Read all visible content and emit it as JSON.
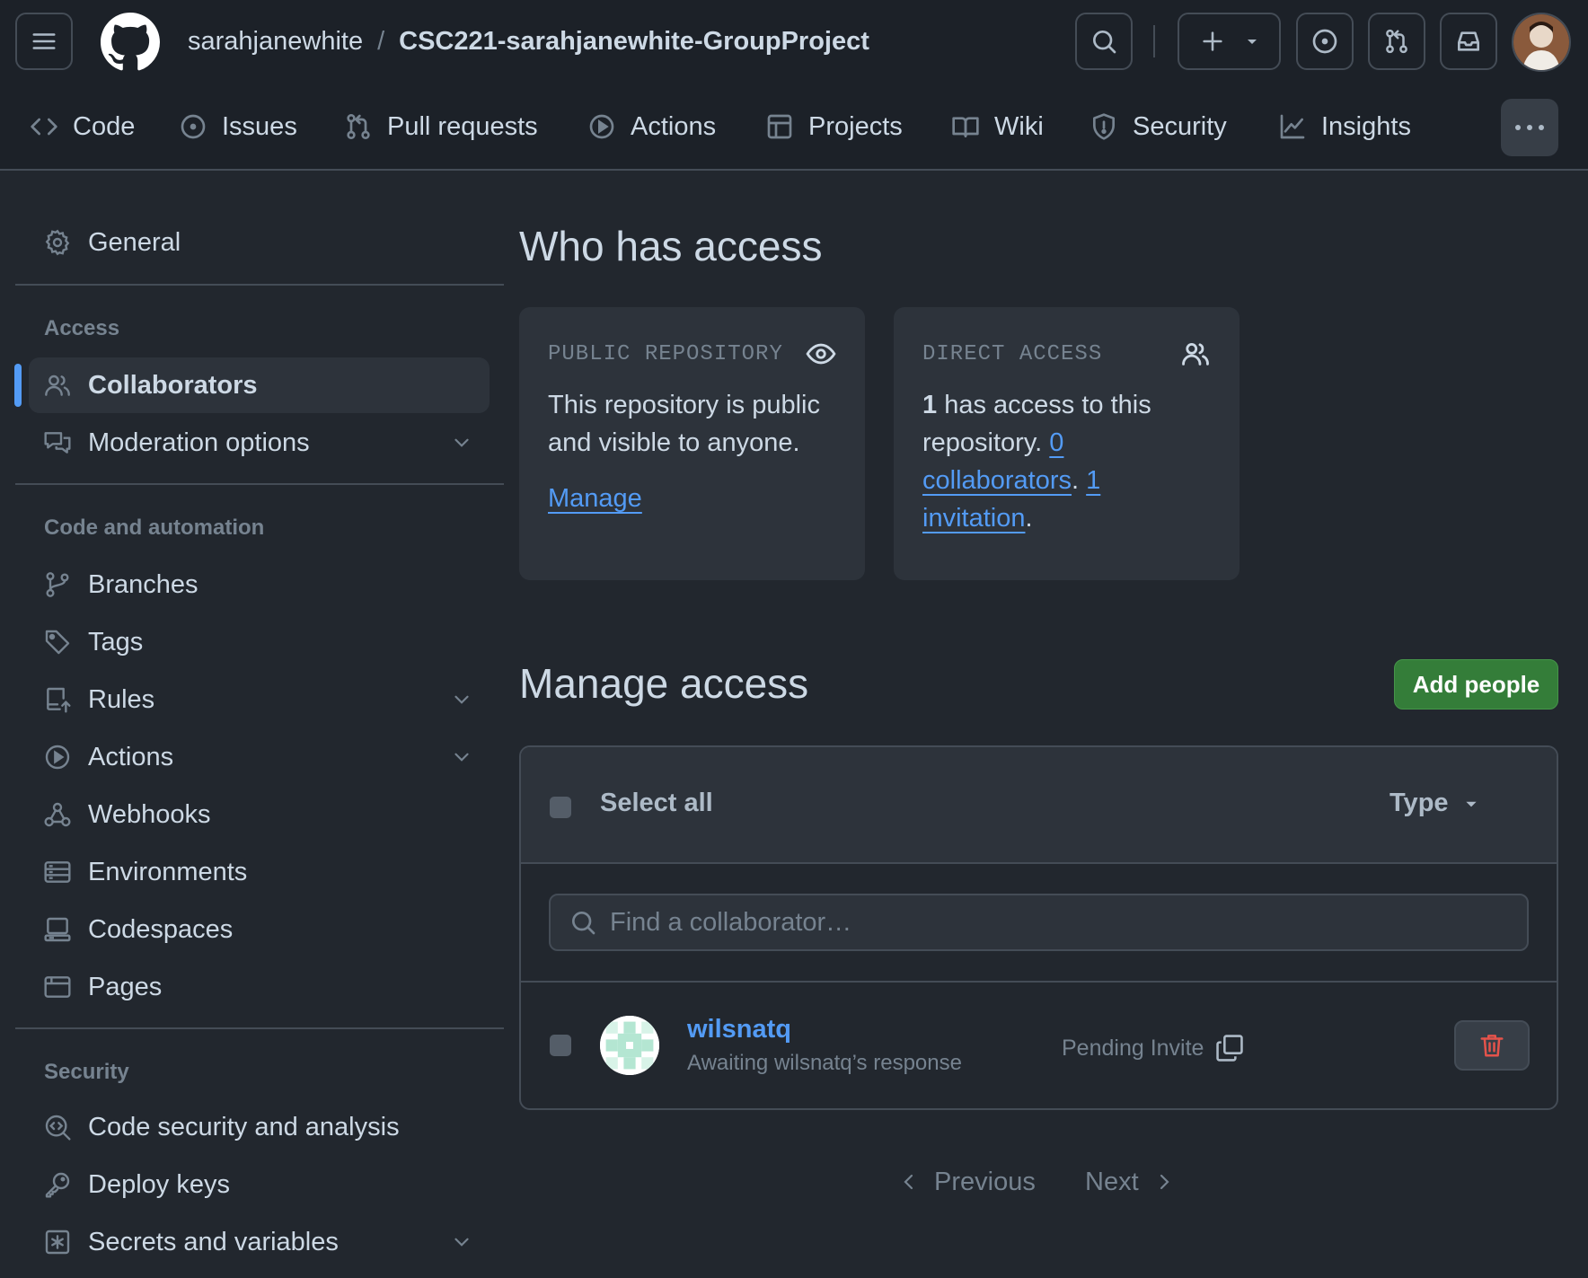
{
  "header": {
    "owner": "sarahjanewhite",
    "separator": "/",
    "repo": "CSC221-sarahjanewhite-GroupProject"
  },
  "repo_nav": {
    "items": [
      {
        "label": "Code",
        "icon": "code-icon"
      },
      {
        "label": "Issues",
        "icon": "issue-icon"
      },
      {
        "label": "Pull requests",
        "icon": "pull-request-icon"
      },
      {
        "label": "Actions",
        "icon": "play-icon"
      },
      {
        "label": "Projects",
        "icon": "table-icon"
      },
      {
        "label": "Wiki",
        "icon": "book-icon"
      },
      {
        "label": "Security",
        "icon": "shield-icon"
      },
      {
        "label": "Insights",
        "icon": "graph-icon"
      }
    ]
  },
  "sidebar": {
    "general": "General",
    "sections": {
      "access": "Access",
      "code_automation": "Code and automation",
      "security": "Security"
    },
    "items": {
      "collaborators": "Collaborators",
      "moderation": "Moderation options",
      "branches": "Branches",
      "tags": "Tags",
      "rules": "Rules",
      "actions": "Actions",
      "webhooks": "Webhooks",
      "environments": "Environments",
      "codespaces": "Codespaces",
      "pages": "Pages",
      "code_security": "Code security and analysis",
      "deploy_keys": "Deploy keys",
      "secrets": "Secrets and variables"
    },
    "active": "collaborators"
  },
  "who_has_access": {
    "title": "Who has access",
    "public_card": {
      "caption": "PUBLIC REPOSITORY",
      "text": "This repository is public and visible to anyone.",
      "link": "Manage"
    },
    "direct_card": {
      "caption": "DIRECT ACCESS",
      "count": "1",
      "text_after_count": " has access to this repository. ",
      "collaborators_link": "0 collaborators",
      "mid": ". ",
      "invitation_link": "1 invitation",
      "end": "."
    }
  },
  "manage_access": {
    "title": "Manage access",
    "add_button": "Add people",
    "select_all": "Select all",
    "type_filter": "Type",
    "search_placeholder": "Find a collaborator…",
    "rows": [
      {
        "username": "wilsnatq",
        "subtitle": "Awaiting wilsnatq’s response",
        "status": "Pending Invite"
      }
    ]
  },
  "pagination": {
    "previous": "Previous",
    "next": "Next"
  },
  "colors": {
    "background": "#22272e",
    "header_background": "#1c2128",
    "link": "#539bf5",
    "add_button": "#347d39",
    "danger": "#e5534b"
  }
}
